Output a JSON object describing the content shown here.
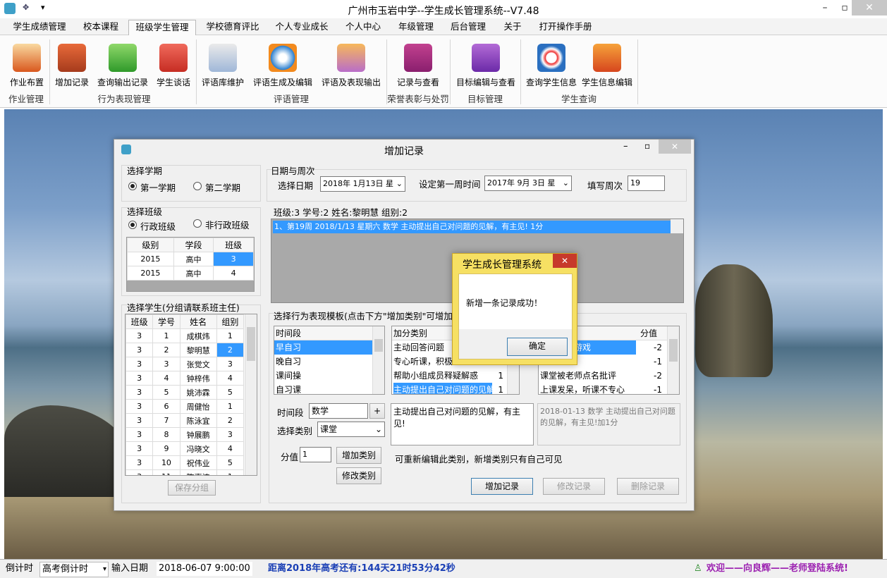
{
  "app": {
    "title": "广州市玉岩中学--学生成长管理系统--V7.48"
  },
  "menu": [
    "学生成绩管理",
    "校本课程",
    "班级学生管理",
    "学校德育评比",
    "个人专业成长",
    "个人中心",
    "年级管理",
    "后台管理",
    "关于",
    "打开操作手册"
  ],
  "ribbon": {
    "buttons": [
      "作业布置",
      "增加记录",
      "查询输出记录",
      "学生谈话",
      "评语库维护",
      "评语生成及编辑",
      "评语及表现输出",
      "记录与查看",
      "目标编辑与查看",
      "查询学生信息",
      "学生信息编辑"
    ],
    "groups": [
      "作业管理",
      "行为表现管理",
      "评语管理",
      "荣誉表彰与处罚",
      "目标管理",
      "学生查询"
    ]
  },
  "dialog": {
    "title": "增加记录",
    "term": {
      "title": "选择学期",
      "opt1": "第一学期",
      "opt2": "第二学期"
    },
    "class": {
      "title": "选择班级",
      "opt1": "行政班级",
      "opt2": "非行政班级",
      "headers": [
        "级别",
        "学段",
        "班级"
      ],
      "rows": [
        [
          "2015",
          "高中",
          "3"
        ],
        [
          "2015",
          "高中",
          "4"
        ]
      ]
    },
    "date": {
      "title": "日期与周次",
      "select_label": "选择日期",
      "select_value": "2018年 1月13日 星",
      "first_week_label": "设定第一周时间",
      "first_week_value": "2017年 9月 3日 星",
      "week_label": "填写周次",
      "week_value": "19"
    },
    "record": {
      "header": "班级:3 学号:2 姓名:黎明慧 组别:2",
      "item": "1、第19周 2018/1/13 星期六 数学 主动提出自己对问题的见解，有主见! 1分"
    },
    "students": {
      "title": "选择学生(分组请联系班主任)",
      "headers": [
        "班级",
        "学号",
        "姓名",
        "组别"
      ],
      "rows": [
        [
          "3",
          "1",
          "成棋炜",
          "1"
        ],
        [
          "3",
          "2",
          "黎明慧",
          "2"
        ],
        [
          "3",
          "3",
          "张觉文",
          "3"
        ],
        [
          "3",
          "4",
          "钟梓伟",
          "4"
        ],
        [
          "3",
          "5",
          "姚沛霖",
          "5"
        ],
        [
          "3",
          "6",
          "周健怡",
          "1"
        ],
        [
          "3",
          "7",
          "陈泳宜",
          "2"
        ],
        [
          "3",
          "8",
          "钟展鹏",
          "3"
        ],
        [
          "3",
          "9",
          "冯晓文",
          "4"
        ],
        [
          "3",
          "10",
          "祝伟业",
          "5"
        ],
        [
          "3",
          "11",
          "陈嘉涛",
          "1"
        ]
      ],
      "save_label": "保存分组"
    },
    "template": {
      "title": "选择行为表现模板(点击下方\"增加类别\"可增加",
      "period_header": "时间段",
      "periods": [
        "早自习",
        "晚自习",
        "课间操",
        "自习课"
      ],
      "bonus_header": "加分类别",
      "bonus": [
        [
          "主动回答问题",
          ""
        ],
        [
          "专心听课，积极",
          ""
        ],
        [
          "帮助小组成员释疑解惑",
          "1"
        ],
        [
          "主动提出自己对问题的见解",
          "1"
        ]
      ],
      "minus_header": "分值",
      "minus": [
        [
          "游戏",
          "-2"
        ],
        [
          "",
          "-1"
        ],
        [
          "课堂被老师点名批评",
          "-2"
        ],
        [
          "上课发呆，听课不专心",
          "-1"
        ]
      ],
      "period_label": "时间段",
      "period_value": "数学",
      "plus_label": "+",
      "category_label": "选择类别",
      "category_value": "课堂",
      "score_label": "分值",
      "score_value": "1",
      "add_category": "增加类别",
      "edit_category": "修改类别",
      "content": "主动提出自己对问题的见解，有主见!",
      "preview": "2018-01-13 数学 主动提出自己对问题的见解，有主见!加1分",
      "note": "可重新编辑此类别，新增类别只有自己可见",
      "add_record": "增加记录",
      "edit_record": "修改记录",
      "delete_record": "删除记录"
    }
  },
  "msgbox": {
    "title": "学生成长管理系统",
    "text": "新增一条记录成功！",
    "ok": "确定",
    "close": "✕"
  },
  "status": {
    "countdown_label": "倒计时",
    "countdown_value": "高考倒计时",
    "date_label": "输入日期",
    "date_value": "2018-06-07  9:00:00",
    "remaining": "距离2018年高考还有:144天21时53分42秒",
    "welcome": "欢迎——向良辉——老师登陆系统!"
  }
}
